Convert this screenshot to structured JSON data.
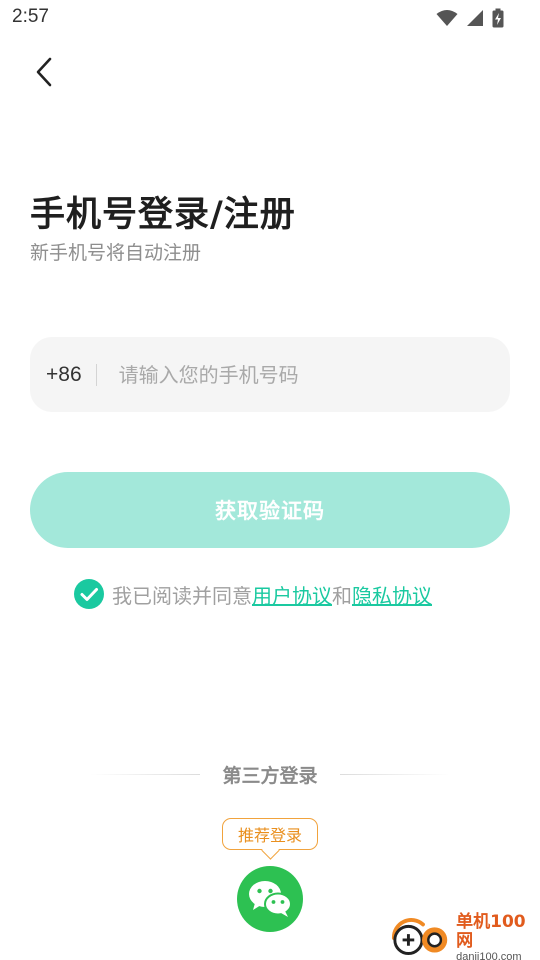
{
  "status_bar": {
    "time": "2:57"
  },
  "header": {
    "back_icon": "chevron-left-icon"
  },
  "title": "手机号登录/注册",
  "subtitle": "新手机号将自动注册",
  "phone": {
    "country_code": "+86",
    "value": "",
    "placeholder": "请输入您的手机号码"
  },
  "get_code_button": "获取验证码",
  "agreement": {
    "prefix": "我已阅读并同意",
    "user_agreement": "用户协议",
    "conjunction": "和",
    "privacy_agreement": "隐私协议",
    "checked": true
  },
  "third_party": {
    "label": "第三方登录",
    "recommend_tag": "推荐登录",
    "wechat_icon": "wechat-icon"
  },
  "watermark": {
    "cn": "单机100网",
    "en": "danji100.com"
  },
  "colors": {
    "accent": "#1ac9a0",
    "button_disabled": "#a3e8da",
    "input_bg": "#f5f5f5",
    "tag_orange": "#f1a33d",
    "wechat_green": "#2dc152"
  }
}
